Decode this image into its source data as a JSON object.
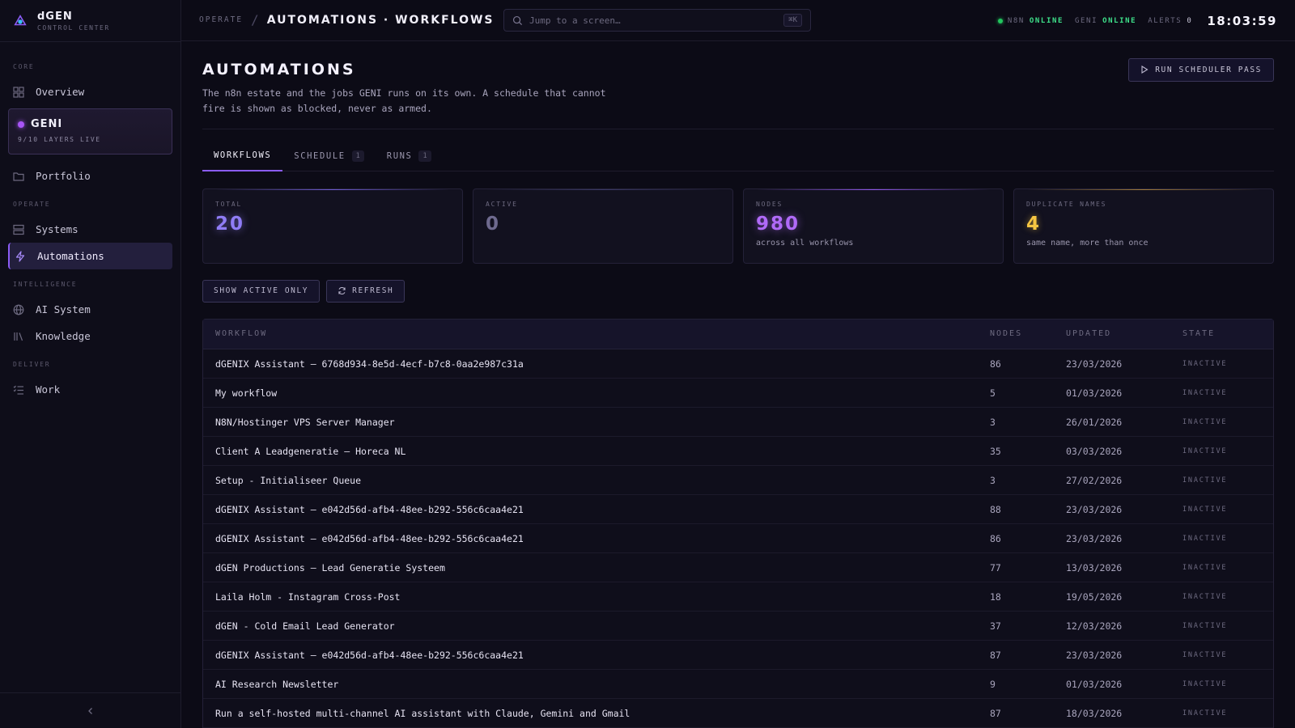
{
  "brand": {
    "name": "dGEN",
    "subtitle": "CONTROL CENTER"
  },
  "sidebar": {
    "sections": {
      "core": "CORE",
      "operate": "OPERATE",
      "intelligence": "INTELLIGENCE",
      "deliver": "DELIVER"
    },
    "items": {
      "overview": "Overview",
      "portfolio": "Portfolio",
      "systems": "Systems",
      "automations": "Automations",
      "ai_system": "AI System",
      "knowledge": "Knowledge",
      "work": "Work"
    },
    "geni": {
      "name": "GENI",
      "status": "9/10 LAYERS LIVE"
    },
    "collapse_icon": "chevron-left-icon"
  },
  "topbar": {
    "crumb_parent": "OPERATE",
    "crumb_sep": "/",
    "crumb_current": "AUTOMATIONS · WORKFLOWS",
    "search_placeholder": "Jump to a screen…",
    "search_shortcut": "⌘K",
    "n8n_label": "N8N",
    "n8n_status": "ONLINE",
    "geni_label": "GENI",
    "geni_status": "ONLINE",
    "alerts_label": "ALERTS",
    "alerts_count": "0",
    "clock": "18:03:59"
  },
  "page": {
    "title": "AUTOMATIONS",
    "description": "The n8n estate and the jobs GENI runs on its own. A schedule that cannot fire is shown as blocked, never as armed.",
    "run_button": "RUN SCHEDULER PASS"
  },
  "tabs": [
    {
      "label": "WORKFLOWS",
      "count": ""
    },
    {
      "label": "SCHEDULE",
      "count": "1"
    },
    {
      "label": "RUNS",
      "count": "1"
    }
  ],
  "cards": [
    {
      "label": "TOTAL",
      "value": "20",
      "note": ""
    },
    {
      "label": "ACTIVE",
      "value": "0",
      "note": ""
    },
    {
      "label": "NODES",
      "value": "980",
      "note": "across all workflows"
    },
    {
      "label": "DUPLICATE NAMES",
      "value": "4",
      "note": "same name, more than once"
    }
  ],
  "actions": {
    "show_active": "SHOW ACTIVE ONLY",
    "refresh": "REFRESH"
  },
  "table": {
    "headers": {
      "workflow": "WORKFLOW",
      "nodes": "NODES",
      "updated": "UPDATED",
      "state": "STATE"
    },
    "rows": [
      {
        "workflow": "dGENIX Assistant — 6768d934-8e5d-4ecf-b7c8-0aa2e987c31a",
        "nodes": "86",
        "updated": "23/03/2026",
        "state": "INACTIVE"
      },
      {
        "workflow": "My workflow",
        "nodes": "5",
        "updated": "01/03/2026",
        "state": "INACTIVE"
      },
      {
        "workflow": "N8N/Hostinger VPS Server Manager",
        "nodes": "3",
        "updated": "26/01/2026",
        "state": "INACTIVE"
      },
      {
        "workflow": "Client A Leadgeneratie — Horeca NL",
        "nodes": "35",
        "updated": "03/03/2026",
        "state": "INACTIVE"
      },
      {
        "workflow": "Setup - Initialiseer Queue",
        "nodes": "3",
        "updated": "27/02/2026",
        "state": "INACTIVE"
      },
      {
        "workflow": "dGENIX Assistant — e042d56d-afb4-48ee-b292-556c6caa4e21",
        "nodes": "88",
        "updated": "23/03/2026",
        "state": "INACTIVE"
      },
      {
        "workflow": "dGENIX Assistant — e042d56d-afb4-48ee-b292-556c6caa4e21",
        "nodes": "86",
        "updated": "23/03/2026",
        "state": "INACTIVE"
      },
      {
        "workflow": "dGEN Productions — Lead Generatie Systeem",
        "nodes": "77",
        "updated": "13/03/2026",
        "state": "INACTIVE"
      },
      {
        "workflow": "Laila Holm - Instagram Cross-Post",
        "nodes": "18",
        "updated": "19/05/2026",
        "state": "INACTIVE"
      },
      {
        "workflow": "dGEN - Cold Email Lead Generator",
        "nodes": "37",
        "updated": "12/03/2026",
        "state": "INACTIVE"
      },
      {
        "workflow": "dGENIX Assistant — e042d56d-afb4-48ee-b292-556c6caa4e21",
        "nodes": "87",
        "updated": "23/03/2026",
        "state": "INACTIVE"
      },
      {
        "workflow": "AI Research Newsletter",
        "nodes": "9",
        "updated": "01/03/2026",
        "state": "INACTIVE"
      },
      {
        "workflow": "Run a self-hosted multi-channel AI assistant with Claude, Gemini and Gmail",
        "nodes": "87",
        "updated": "18/03/2026",
        "state": "INACTIVE"
      }
    ]
  },
  "colors": {
    "accent": "#8b5cf6",
    "online": "#3ee08a",
    "warning": "#f5c542",
    "background": "#0c0b16"
  }
}
